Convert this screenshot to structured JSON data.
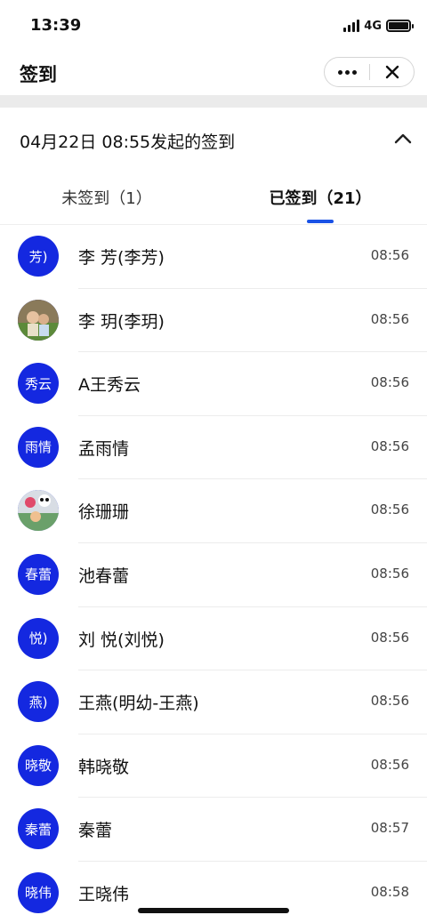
{
  "status_bar": {
    "time": "13:39",
    "network": "4G"
  },
  "nav": {
    "title": "签到"
  },
  "header": {
    "title": "04月22日 08:55发起的签到"
  },
  "tabs": [
    {
      "label": "未签到（1）",
      "active": false
    },
    {
      "label": "已签到（21）",
      "active": true
    }
  ],
  "colors": {
    "accent": "#1a52e6",
    "avatar": "#1428e0"
  },
  "list": [
    {
      "avatar": "芳)",
      "name": "李 芳(李芳)",
      "time": "08:56"
    },
    {
      "avatar": "",
      "avatar_type": "photo",
      "name": "李 玥(李玥)",
      "time": "08:56"
    },
    {
      "avatar": "秀云",
      "name": "A王秀云",
      "time": "08:56"
    },
    {
      "avatar": "雨情",
      "name": "孟雨情",
      "time": "08:56"
    },
    {
      "avatar": "",
      "avatar_type": "photo",
      "name": "徐珊珊",
      "time": "08:56"
    },
    {
      "avatar": "春蕾",
      "name": "池春蕾",
      "time": "08:56"
    },
    {
      "avatar": "悦)",
      "name": "刘 悦(刘悦)",
      "time": "08:56"
    },
    {
      "avatar": "燕)",
      "name": "王燕(明幼-王燕)",
      "time": "08:56"
    },
    {
      "avatar": "晓敬",
      "name": "韩晓敬",
      "time": "08:56"
    },
    {
      "avatar": "秦蕾",
      "name": "秦蕾",
      "time": "08:57"
    },
    {
      "avatar": "晓伟",
      "name": "王晓伟",
      "time": "08:58"
    }
  ]
}
